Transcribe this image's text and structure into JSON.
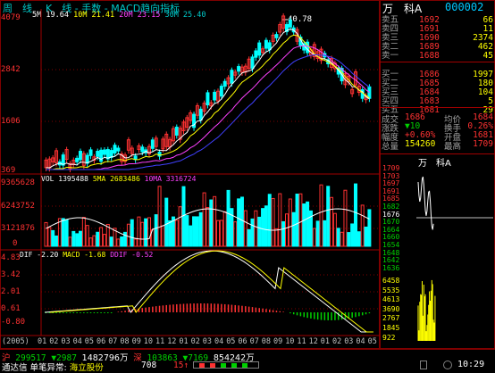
{
  "header": {
    "period": "周　线",
    "kline": "K　线",
    "sep1": "-",
    "volume_mode": "手数",
    "sep2": "-",
    "indicator": "MACD趋向指标",
    "ma_line": {
      "ma5": "5M 19.64",
      "ma10": "10M 21.41",
      "ma20": "20M 23.15",
      "ma30": "30M 25.40"
    }
  },
  "price_axis": [
    "4079",
    "2842",
    "1606",
    "369"
  ],
  "price_annotation": "40.78",
  "volume_info": {
    "vol": "VOL 1395488",
    "ma5": "5MA 2683486",
    "ma10": "10MA 3316724"
  },
  "volume_axis": [
    "9365628",
    "6243752",
    "3121876",
    "0"
  ],
  "macd_info": {
    "dif": "DIF -2.20",
    "macd": "MACD -1.68",
    "ddif": "DDIF -0.52"
  },
  "macd_axis": [
    "4.83",
    "3.42",
    "2.01",
    "0.61",
    "-0.80"
  ],
  "time_axis": [
    "(2005)",
    "01",
    "02",
    "03",
    "04",
    "05",
    "06",
    "07",
    "08",
    "09",
    "10",
    "11",
    "12",
    "01",
    "02",
    "03",
    "04",
    "05",
    "06",
    "07",
    "08",
    "09",
    "10",
    "11",
    "12",
    "01",
    "02",
    "03",
    "04",
    "05"
  ],
  "stock": {
    "name": "万　科A",
    "code": "000002"
  },
  "quote_table": [
    {
      "label": "卖五",
      "price": "1692",
      "volume": "66"
    },
    {
      "label": "卖四",
      "price": "1691",
      "volume": "11"
    },
    {
      "label": "卖三",
      "price": "1690",
      "volume": "2374"
    },
    {
      "label": "卖二",
      "price": "1689",
      "volume": "462"
    },
    {
      "label": "卖一",
      "price": "1688",
      "volume": "45"
    },
    {
      "label": "买一",
      "price": "1686",
      "volume": "1997"
    },
    {
      "label": "买二",
      "price": "1685",
      "volume": "180"
    },
    {
      "label": "买三",
      "price": "1684",
      "volume": "104"
    },
    {
      "label": "买四",
      "price": "1683",
      "volume": "5"
    },
    {
      "label": "买五",
      "price": "1681",
      "volume": "29"
    }
  ],
  "stats": [
    {
      "l1": "成交",
      "v1": "1686",
      "l2": "均价",
      "v2": "1684"
    },
    {
      "l1": "涨跌",
      "v1": "▼10",
      "l2": "换手",
      "v2": "0.26%"
    },
    {
      "l1": "幅度",
      "v1": "+0.60%",
      "l2": "开盘",
      "v2": "1681"
    },
    {
      "l1": "总量",
      "v1": "154260",
      "l2": "最高",
      "v2": "1709"
    }
  ],
  "mini_chart": {
    "title": "万　科A",
    "price_ticks": [
      "1709",
      "1703",
      "1697",
      "1691",
      "1685",
      "1682",
      "1676",
      "1670",
      "1664",
      "1660",
      "1654",
      "1648",
      "1642",
      "1636"
    ],
    "volume_ticks": [
      "6458",
      "5535",
      "4613",
      "3690",
      "2767",
      "1845",
      "922"
    ]
  },
  "bottom": {
    "sh_label": "沪",
    "sh_index": "299517",
    "sh_change": "▼2987",
    "sh_amount": "1482796万",
    "sz_label": "深",
    "sz_index": "103863",
    "sz_change": "▼7169",
    "sz_amount": "854242万",
    "ticker_label": "通达信",
    "ticker_sep": "单笔异常:",
    "ticker_stock": "海立股份",
    "ticker_vol": "708",
    "ticker_num": "15↑",
    "time": "10:29"
  },
  "colors": {
    "up": "#ff3232",
    "down": "#00ffff",
    "ma5": "#ffffff",
    "ma10": "#ffff00",
    "ma20": "#ff40ff",
    "ma30": "#4040ff"
  }
}
